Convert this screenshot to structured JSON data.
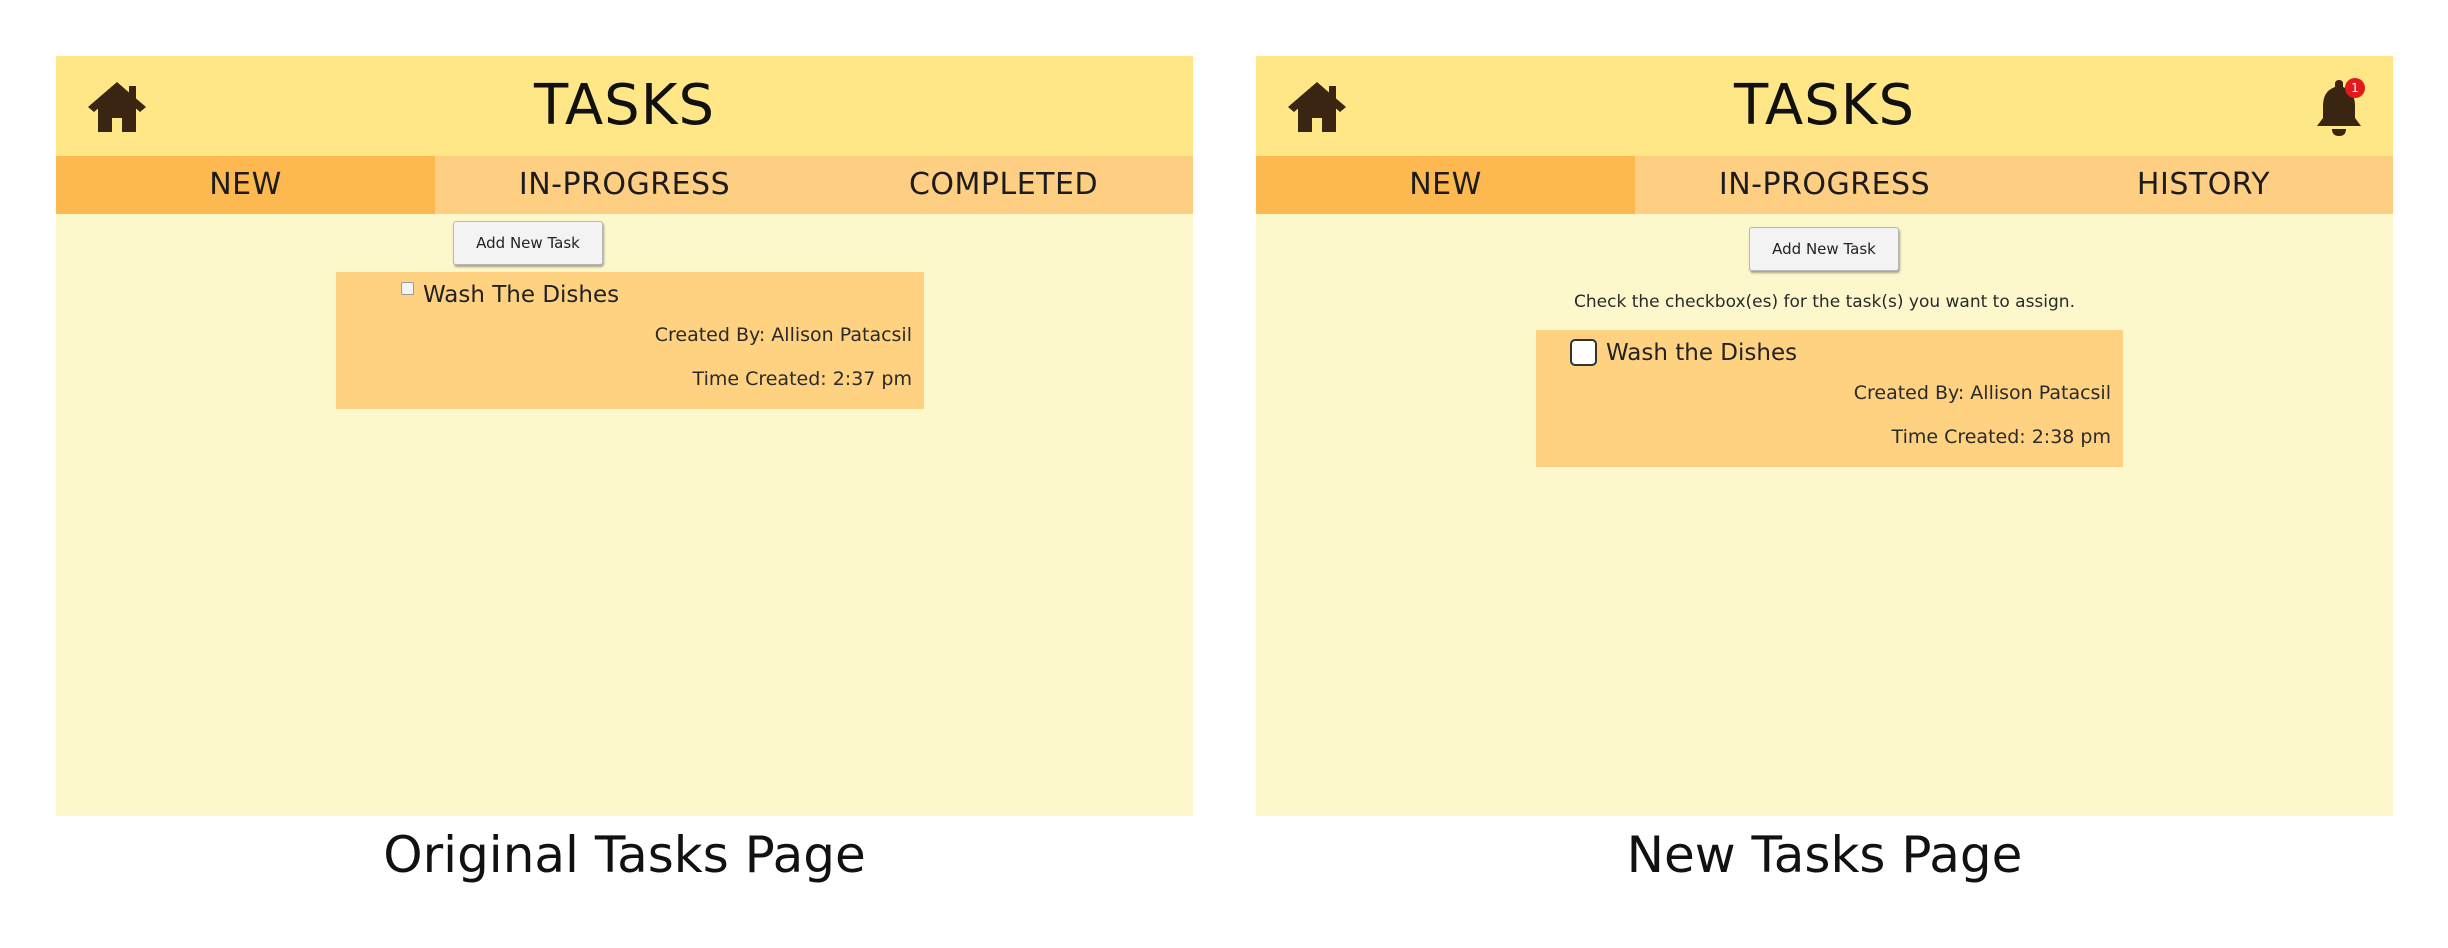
{
  "original": {
    "header": {
      "title": "TASKS"
    },
    "tabs": [
      {
        "label": "NEW",
        "active": true
      },
      {
        "label": "IN-PROGRESS",
        "active": false
      },
      {
        "label": "COMPLETED",
        "active": false
      }
    ],
    "add_button_label": "Add New Task",
    "task": {
      "name": "Wash The Dishes",
      "created_by": "Created By: Allison Patacsil",
      "time_created": "Time Created: 2:37 pm",
      "checked": false
    },
    "caption": "Original Tasks Page"
  },
  "new": {
    "header": {
      "title": "TASKS",
      "notification_count": "1"
    },
    "tabs": [
      {
        "label": "NEW",
        "active": true
      },
      {
        "label": "IN-PROGRESS",
        "active": false
      },
      {
        "label": "HISTORY",
        "active": false
      }
    ],
    "add_button_label": "Add New Task",
    "instructions": "Check the checkbox(es) for the task(s) you want to assign.",
    "task": {
      "name": "Wash the Dishes",
      "created_by": "Created By: Allison Patacsil",
      "time_created": "Time Created: 2:38 pm",
      "checked": false
    },
    "caption": "New Tasks Page"
  },
  "icons": {
    "home": "home-icon",
    "bell": "bell-icon"
  },
  "colors": {
    "header_bg": "#ffe686",
    "tab_bg": "#fecf83",
    "tab_active_bg": "#feb850",
    "page_bg": "#fdf7cc",
    "card_bg": "#fed281",
    "badge": "#e3191b",
    "icon": "#3a2412"
  }
}
